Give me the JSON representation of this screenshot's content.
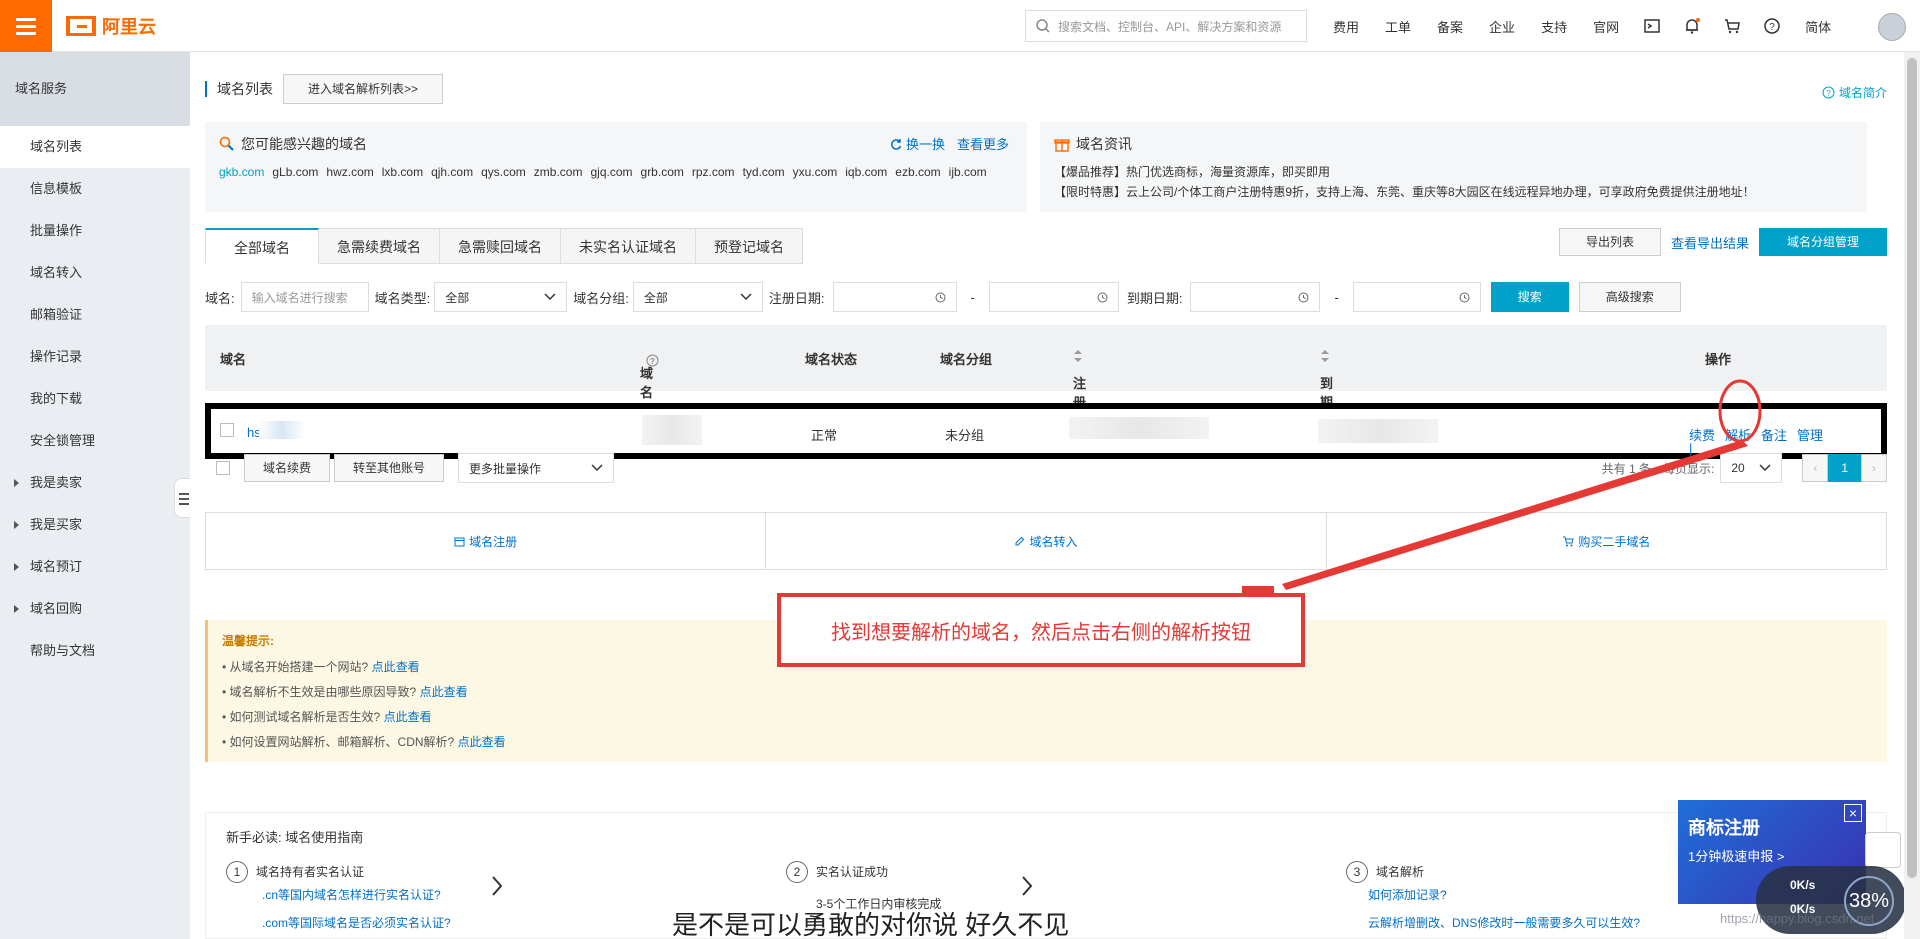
{
  "brand": {
    "name": "阿里云",
    "color": "#ff6a00"
  },
  "header": {
    "search_placeholder": "搜索文档、控制台、API、解决方案和资源",
    "nav": [
      "费用",
      "工单",
      "备案",
      "企业",
      "支持",
      "官网"
    ],
    "lang": "简体"
  },
  "sidebar": {
    "title": "域名服务",
    "items": [
      {
        "label": "域名列表",
        "active": true,
        "expandable": false
      },
      {
        "label": "信息模板",
        "expandable": false
      },
      {
        "label": "批量操作",
        "expandable": false
      },
      {
        "label": "域名转入",
        "expandable": false
      },
      {
        "label": "邮箱验证",
        "expandable": false
      },
      {
        "label": "操作记录",
        "expandable": false
      },
      {
        "label": "我的下载",
        "expandable": false
      },
      {
        "label": "安全锁管理",
        "expandable": false
      },
      {
        "label": "我是卖家",
        "expandable": true
      },
      {
        "label": "我是买家",
        "expandable": true
      },
      {
        "label": "域名预订",
        "expandable": true
      },
      {
        "label": "域名回购",
        "expandable": true
      },
      {
        "label": "帮助与文档",
        "expandable": false
      }
    ]
  },
  "page": {
    "title": "域名列表",
    "dns_list_button": "进入域名解析列表>>",
    "help_link": "域名简介"
  },
  "suggest": {
    "title": "您可能感兴趣的域名",
    "refresh": "换一换",
    "more": "查看更多",
    "domains": [
      "gkb.com",
      "gLb.com",
      "hwz.com",
      "lxb.com",
      "qjh.com",
      "qys.com",
      "zmb.com",
      "gjq.com",
      "grb.com",
      "rpz.com",
      "tyd.com",
      "yxu.com",
      "iqb.com",
      "ezb.com",
      "ijb.com"
    ]
  },
  "news": {
    "title": "域名资讯",
    "lines": [
      "【爆品推荐】热门优选商标，海量资源库，即买即用",
      "【限时特惠】云上公司/个体工商户注册特惠9折，支持上海、东莞、重庆等8大园区在线远程异地办理，可享政府免费提供注册地址！"
    ]
  },
  "tabs": [
    "全部域名",
    "急需续费域名",
    "急需赎回域名",
    "未实名认证域名",
    "预登记域名"
  ],
  "actions": {
    "export": "导出列表",
    "view_export": "查看导出结果",
    "group_manage": "域名分组管理"
  },
  "filter": {
    "domain_label": "域名:",
    "domain_placeholder": "输入域名进行搜索",
    "type_label": "域名类型:",
    "type_value": "全部",
    "group_label": "域名分组:",
    "group_value": "全部",
    "reg_label": "注册日期:",
    "exp_label": "到期日期:",
    "dash": "-",
    "search": "搜索",
    "advanced": "高级搜索"
  },
  "table": {
    "headers": {
      "domain": "域名",
      "type": "域名类型",
      "status": "域名状态",
      "group": "域名分组",
      "reg": "注册日期",
      "exp": "到期日期",
      "ops": "操作"
    },
    "row": {
      "domain": "hs",
      "status": "正常",
      "group": "未分组",
      "ops": [
        "续费",
        "解析",
        "备注",
        "管理"
      ]
    }
  },
  "bulk": {
    "renew": "域名续费",
    "transfer": "转至其他账号",
    "more": "更多批量操作",
    "total": "共有 1 条，每页显示:",
    "page_size": "20",
    "page": "1"
  },
  "quick": [
    "域名注册",
    "域名转入",
    "购买二手域名"
  ],
  "tips": {
    "title": "温馨提示:",
    "items": [
      {
        "text": "• 从域名开始搭建一个网站?",
        "link": "点此查看"
      },
      {
        "text": "• 域名解析不生效是由哪些原因导致?",
        "link": "点此查看"
      },
      {
        "text": "• 如何测试域名解析是否生效?",
        "link": "点此查看"
      },
      {
        "text": "• 如何设置网站解析、邮箱解析、CDN解析?",
        "link": "点此查看"
      }
    ]
  },
  "guide": {
    "title": "新手必读: 域名使用指南",
    "steps": [
      {
        "num": "1",
        "title": "域名持有者实名认证",
        "links": [
          ".cn等国内域名怎样进行实名认证?",
          ".com等国际域名是否必须实名认证?"
        ]
      },
      {
        "num": "2",
        "title": "实名认证成功",
        "sub": "3-5个工作日内审核完成"
      },
      {
        "num": "3",
        "title": "域名解析",
        "links": [
          "如何添加记录?",
          "云解析增删改、DNS修改时一般需要多久可以生效?"
        ]
      }
    ]
  },
  "annotation": "找到想要解析的域名，然后点击右侧的解析按钮",
  "promo": {
    "title": "商标注册",
    "sub": "1分钟极速申报 >"
  },
  "speed": {
    "up": "0K/s",
    "down": "0K/s",
    "percent": "38%"
  },
  "subtitle": "是不是可以勇敢的对你说 好久不见",
  "watermark": "https://happy.blog.csdn.net"
}
